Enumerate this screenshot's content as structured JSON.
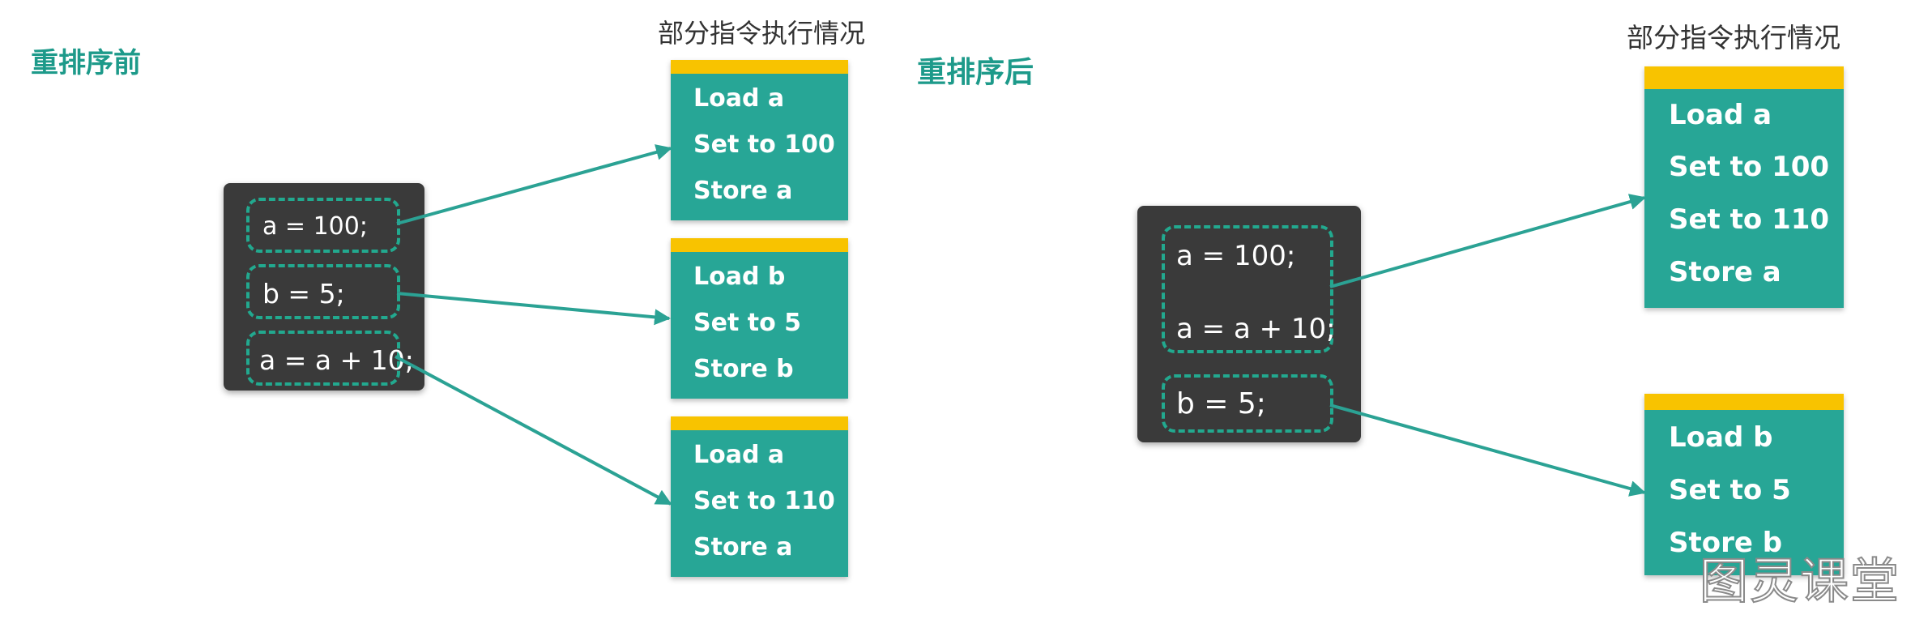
{
  "before": {
    "title": "重排序前",
    "caption": "部分指令执行情况",
    "statements": [
      "a = 100;",
      "b = 5;",
      "a = a + 10;"
    ],
    "instruction_groups": [
      [
        "Load a",
        "Set to 100",
        "Store a"
      ],
      [
        "Load b",
        "Set to 5",
        "Store b"
      ],
      [
        "Load a",
        "Set to 110",
        "Store a"
      ]
    ]
  },
  "after": {
    "title": "重排序后",
    "caption": "部分指令执行情况",
    "statements": [
      "a = 100;",
      "a = a + 10;",
      "b = 5;"
    ],
    "instruction_groups": [
      [
        "Load a",
        "Set to 100",
        "Set to 110",
        "Store a"
      ],
      [
        "Load b",
        "Set to 5",
        "Store b"
      ]
    ]
  },
  "watermark": "图灵课堂",
  "colors": {
    "heading": "#1d9a8a",
    "code_background": "#3a3a3a",
    "dashed_border": "#22a98f",
    "instruction_box": "#27a696",
    "instruction_header": "#f8c300",
    "arrow": "#2ba294"
  }
}
